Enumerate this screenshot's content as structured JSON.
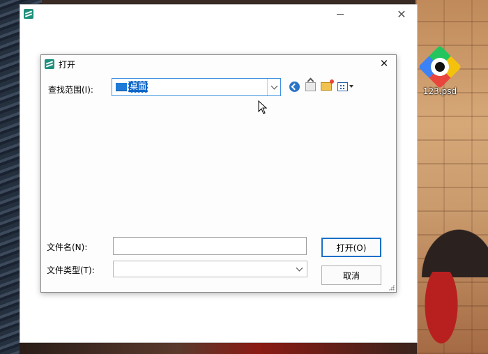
{
  "desktop": {
    "icon_label": "123.psd"
  },
  "app_window": {
    "close_glyph": "✕"
  },
  "dialog": {
    "title": "打开",
    "close_glyph": "✕",
    "look_in": {
      "label": "查找范围(I):",
      "value": "桌面"
    },
    "file_name": {
      "label": "文件名(N):",
      "value": ""
    },
    "file_type": {
      "label": "文件类型(T):",
      "value": ""
    },
    "buttons": {
      "open": "打开(O)",
      "cancel": "取消"
    }
  },
  "colors": {
    "focus_blue": "#1a6fc8",
    "selection_blue": "#0a64c8",
    "app_logo_teal": "#1f8f7d"
  },
  "icons": [
    "app-logo-icon",
    "minimize-icon",
    "close-icon",
    "desktop-folder-icon",
    "back-icon",
    "up-one-level-icon",
    "new-folder-icon",
    "view-menu-icon",
    "chevron-down-icon",
    "resize-grip-icon",
    "mouse-cursor-icon",
    "psd-file-icon"
  ]
}
